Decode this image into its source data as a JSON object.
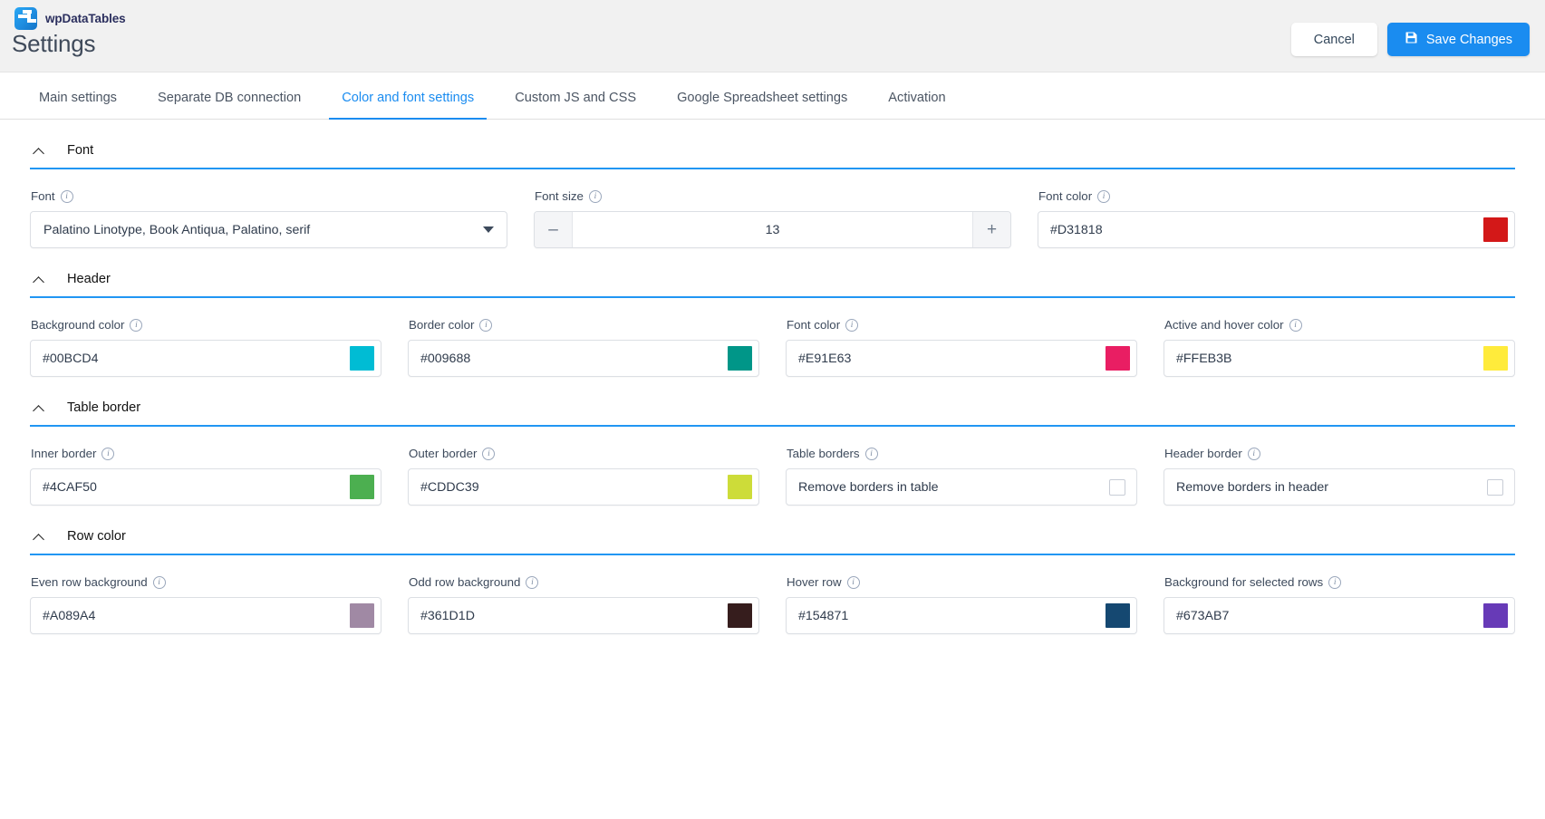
{
  "app": {
    "brand_name": "wpDataTables",
    "page_title": "Settings"
  },
  "topbar": {
    "cancel_label": "Cancel",
    "save_label": "Save Changes",
    "save_icon": "floppy-disk-icon",
    "save_bg": "#1a8cf0"
  },
  "tabs": [
    {
      "label": "Main settings",
      "active": false
    },
    {
      "label": "Separate DB connection",
      "active": false
    },
    {
      "label": "Color and font settings",
      "active": true
    },
    {
      "label": "Custom JS and CSS",
      "active": false
    },
    {
      "label": "Google Spreadsheet settings",
      "active": false
    },
    {
      "label": "Activation",
      "active": false
    }
  ],
  "sections": [
    {
      "title": "Font",
      "fields": [
        {
          "label": "Font",
          "type": "select",
          "value": "Palatino Linotype, Book Antiqua, Palatino, serif"
        },
        {
          "label": "Font size",
          "type": "stepper",
          "value": "13",
          "minus": "–",
          "plus": "+"
        },
        {
          "label": "Font color",
          "type": "color",
          "value": "#D31818",
          "swatch": "#D31818"
        }
      ]
    },
    {
      "title": "Header",
      "fields": [
        {
          "label": "Background color",
          "type": "color",
          "value": "#00BCD4",
          "swatch": "#00BCD4"
        },
        {
          "label": "Border color",
          "type": "color",
          "value": "#009688",
          "swatch": "#009688"
        },
        {
          "label": "Font color",
          "type": "color",
          "value": "#E91E63",
          "swatch": "#E91E63"
        },
        {
          "label": "Active and hover color",
          "type": "color",
          "value": "#FFEB3B",
          "swatch": "#FFEB3B"
        }
      ]
    },
    {
      "title": "Table border",
      "fields": [
        {
          "label": "Inner border",
          "type": "color",
          "value": "#4CAF50",
          "swatch": "#4CAF50"
        },
        {
          "label": "Outer border",
          "type": "color",
          "value": "#CDDC39",
          "swatch": "#CDDC39"
        },
        {
          "label": "Table borders",
          "type": "checkbox",
          "value": "Remove borders in table",
          "checked": false
        },
        {
          "label": "Header border",
          "type": "checkbox",
          "value": "Remove borders in header",
          "checked": false
        }
      ]
    },
    {
      "title": "Row color",
      "fields": [
        {
          "label": "Even row background",
          "type": "color",
          "value": "#A089A4",
          "swatch": "#A089A4"
        },
        {
          "label": "Odd row background",
          "type": "color",
          "value": "#361D1D",
          "swatch": "#361D1D"
        },
        {
          "label": "Hover row",
          "type": "color",
          "value": "#154871",
          "swatch": "#154871"
        },
        {
          "label": "Background for selected rows",
          "type": "color",
          "value": "#673AB7",
          "swatch": "#673AB7"
        }
      ]
    }
  ]
}
